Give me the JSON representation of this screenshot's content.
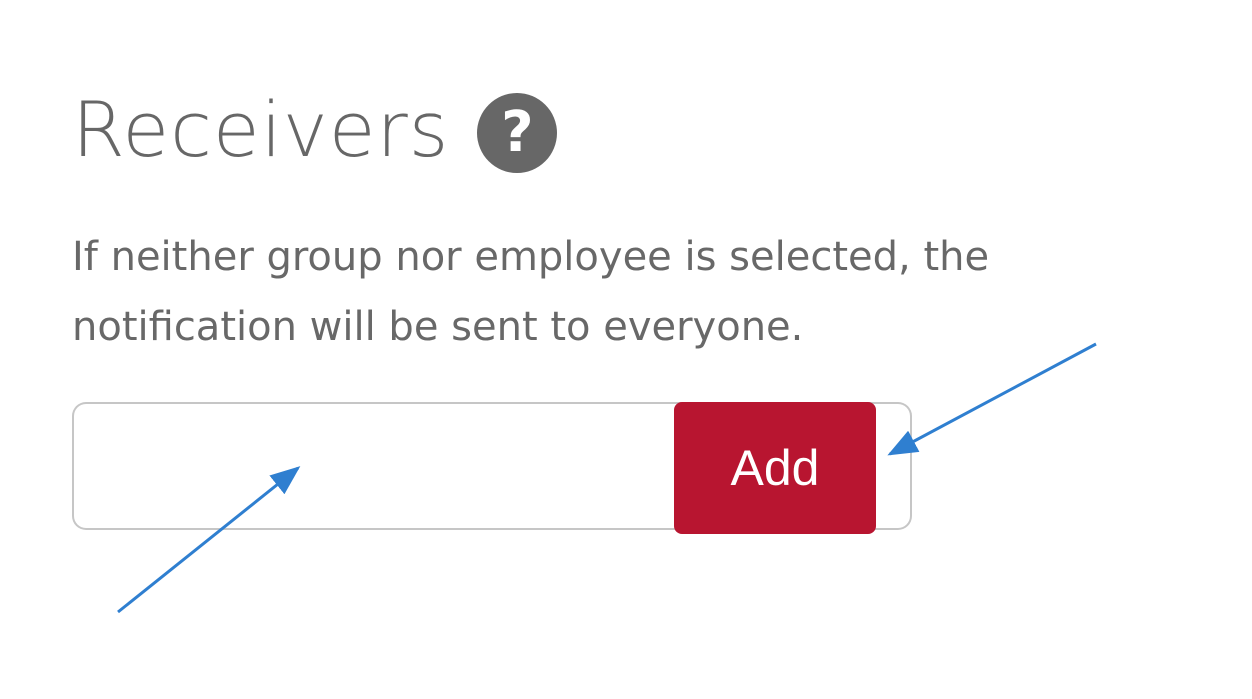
{
  "receivers": {
    "title": "Receivers",
    "help_icon": "question-circle-icon",
    "help_glyph": "?",
    "description": "If neither group nor employee is selected, the notification will be sent to everyone.",
    "input": {
      "value": "",
      "placeholder": ""
    },
    "add_label": "Add"
  },
  "colors": {
    "text": "#676767",
    "button": "#b81530",
    "input_border": "#c6c6c6",
    "annotation_arrow": "#2f7fd0"
  }
}
